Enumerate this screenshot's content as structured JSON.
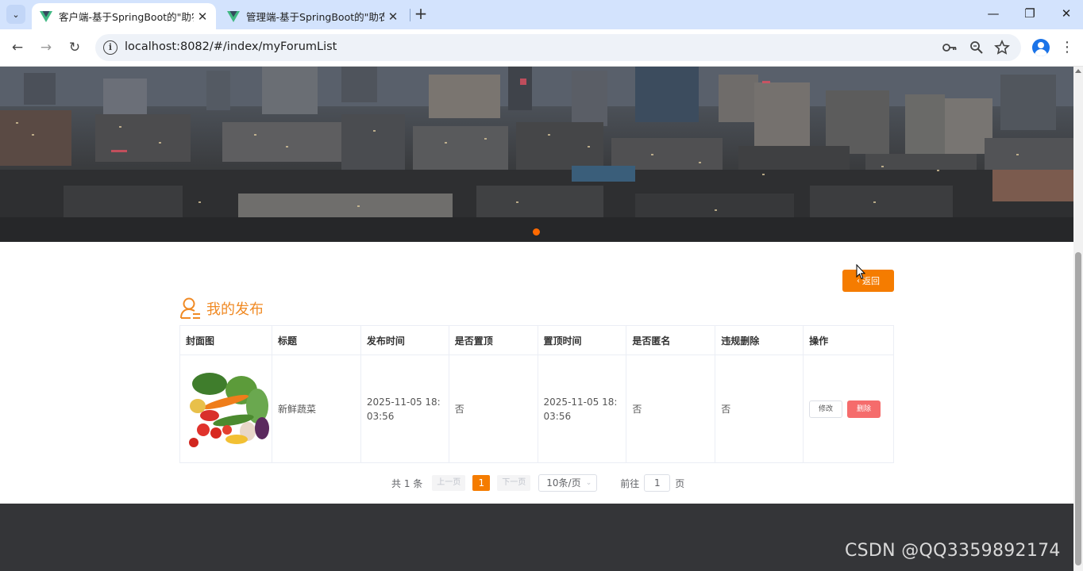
{
  "browser": {
    "tabs": [
      {
        "title": "客户端-基于SpringBoot的\"助农",
        "active": true
      },
      {
        "title": "管理端-基于SpringBoot的\"助农",
        "active": false
      }
    ],
    "url": "localhost:8082/#/index/myForumList",
    "icons": [
      "tab-search-icon",
      "vue-logo-icon",
      "close-icon",
      "new-tab-icon",
      "minimize-icon",
      "restore-icon",
      "window-close-icon",
      "back-arrow-icon",
      "forward-arrow-icon",
      "reload-icon",
      "site-info-icon",
      "password-key-icon",
      "zoom-icon",
      "bookmark-star-icon",
      "profile-icon",
      "menu-dots-icon"
    ]
  },
  "page": {
    "back_button": "返回",
    "section_title": "我的发布",
    "table": {
      "headers": [
        "封面图",
        "标题",
        "发布时间",
        "是否置顶",
        "置顶时间",
        "是否匿名",
        "违规删除",
        "操作"
      ],
      "rows": [
        {
          "cover": "vegetables-image",
          "title": "新鲜蔬菜",
          "publish_time": "2025-11-05 18:03:56",
          "is_top": "否",
          "top_time": "2025-11-05 18:03:56",
          "is_anonymous": "否",
          "violation_deleted": "否",
          "edit_label": "修改",
          "delete_label": "删除"
        }
      ]
    },
    "pagination": {
      "total_text": "共 1 条",
      "prev_label": "上一页",
      "current_page": "1",
      "next_label": "下一页",
      "page_size": "10条/页",
      "goto_label": "前往",
      "goto_value": "1",
      "page_suffix": "页"
    }
  },
  "colors": {
    "accent": "#f57c00",
    "title": "#f08a24",
    "danger": "#f56c6c",
    "footer": "#343538"
  },
  "watermark": "CSDN @QQ3359892174"
}
